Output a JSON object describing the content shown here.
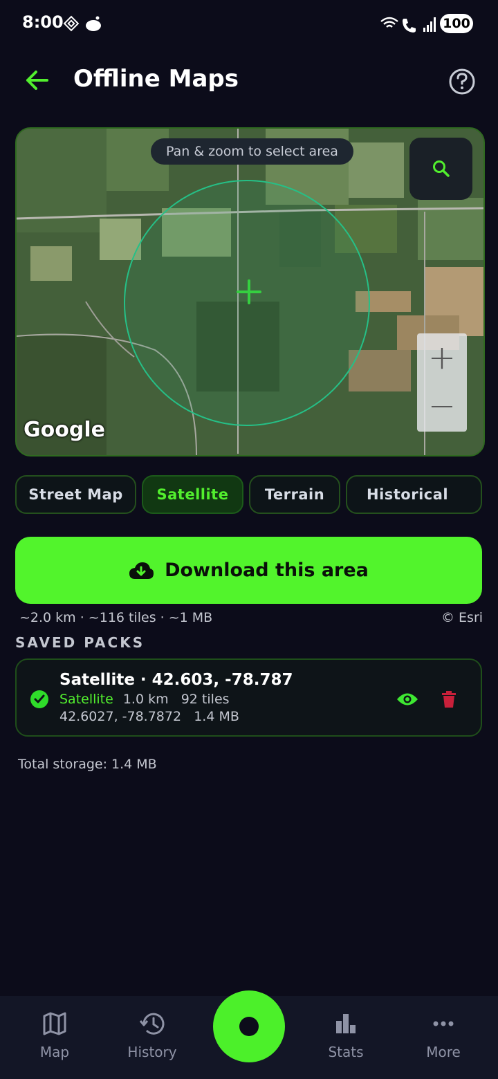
{
  "status_bar": {
    "time": "8:00",
    "battery": "100",
    "icons": [
      "diamond-icon",
      "reddit-icon",
      "wifi-icon",
      "call-icon",
      "signal-icon"
    ]
  },
  "header": {
    "title": "Offline Maps",
    "back_icon": "arrow-left-icon",
    "help_icon": "help-icon"
  },
  "map": {
    "hint": "Pan & zoom to select area",
    "zoom_in": "+",
    "zoom_out": "−",
    "provider_logo": "Google"
  },
  "tabs": [
    {
      "label": "Street Map",
      "active": false
    },
    {
      "label": "Satellite",
      "active": true
    },
    {
      "label": "Terrain",
      "active": false
    },
    {
      "label": "Historical",
      "active": false
    }
  ],
  "download": {
    "label": "Download this area",
    "estimate": "~2.0 km · ~116 tiles · ~1 MB",
    "attribution": "© Esri"
  },
  "saved_packs": {
    "section_title": "SAVED PACKS",
    "items": [
      {
        "title": "Satellite · 42.603, -78.787",
        "type": "Satellite",
        "details": "1.0 km   92 tiles",
        "coords_size": "42.6027, -78.7872   1.4 MB"
      }
    ],
    "total_storage": "Total storage: 1.4 MB"
  },
  "bottom_nav": {
    "items": [
      {
        "label": "Map",
        "icon": "map-icon"
      },
      {
        "label": "History",
        "icon": "history-icon"
      },
      {
        "label": "Stats",
        "icon": "stats-icon"
      },
      {
        "label": "More",
        "icon": "more-icon"
      }
    ],
    "center_icon": "record-icon"
  },
  "colors": {
    "accent": "#52f42c",
    "background": "#0c0c1a",
    "delete": "#c8203a"
  }
}
